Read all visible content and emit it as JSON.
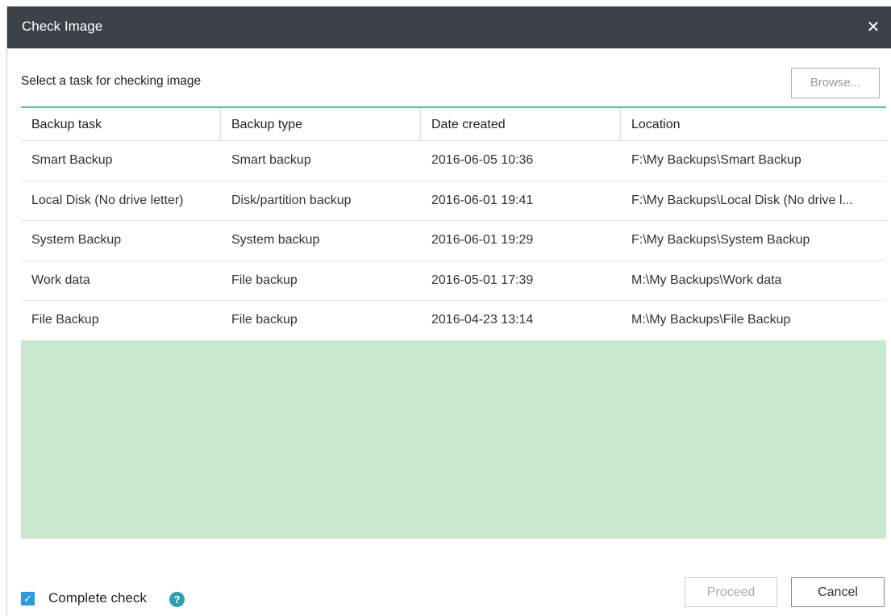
{
  "window": {
    "title": "Check Image",
    "close_glyph": "✕"
  },
  "instructions": "Select a task for checking image",
  "browse_label": "Browse...",
  "table": {
    "columns": [
      "Backup task",
      "Backup type",
      "Date created",
      "Location"
    ],
    "rows": [
      [
        "Smart Backup",
        "Smart backup",
        "2016-06-05 10:36",
        "F:\\My Backups\\Smart Backup"
      ],
      [
        "Local Disk (No drive letter)",
        "Disk/partition backup",
        "2016-06-01 19:41",
        "F:\\My Backups\\Local Disk (No drive l..."
      ],
      [
        "System Backup",
        "System backup",
        "2016-06-01 19:29",
        "F:\\My Backups\\System Backup"
      ],
      [
        "Work data",
        "File backup",
        "2016-05-01 17:39",
        "M:\\My Backups\\Work data"
      ],
      [
        "File Backup",
        "File backup",
        "2016-04-23 13:14",
        "M:\\My Backups\\File Backup"
      ]
    ]
  },
  "complete_check": {
    "label": "Complete check",
    "checked": true,
    "icon": "checkmark-icon",
    "help_icon": "question-icon",
    "help_glyph": "?"
  },
  "footer": {
    "proceed_label": "Proceed",
    "cancel_label": "Cancel"
  },
  "colors": {
    "titlebar": "#3d4148",
    "accent": "#5bb7bb",
    "empty_area": "#c8e9cf",
    "checkbox": "#2d9ad9"
  }
}
